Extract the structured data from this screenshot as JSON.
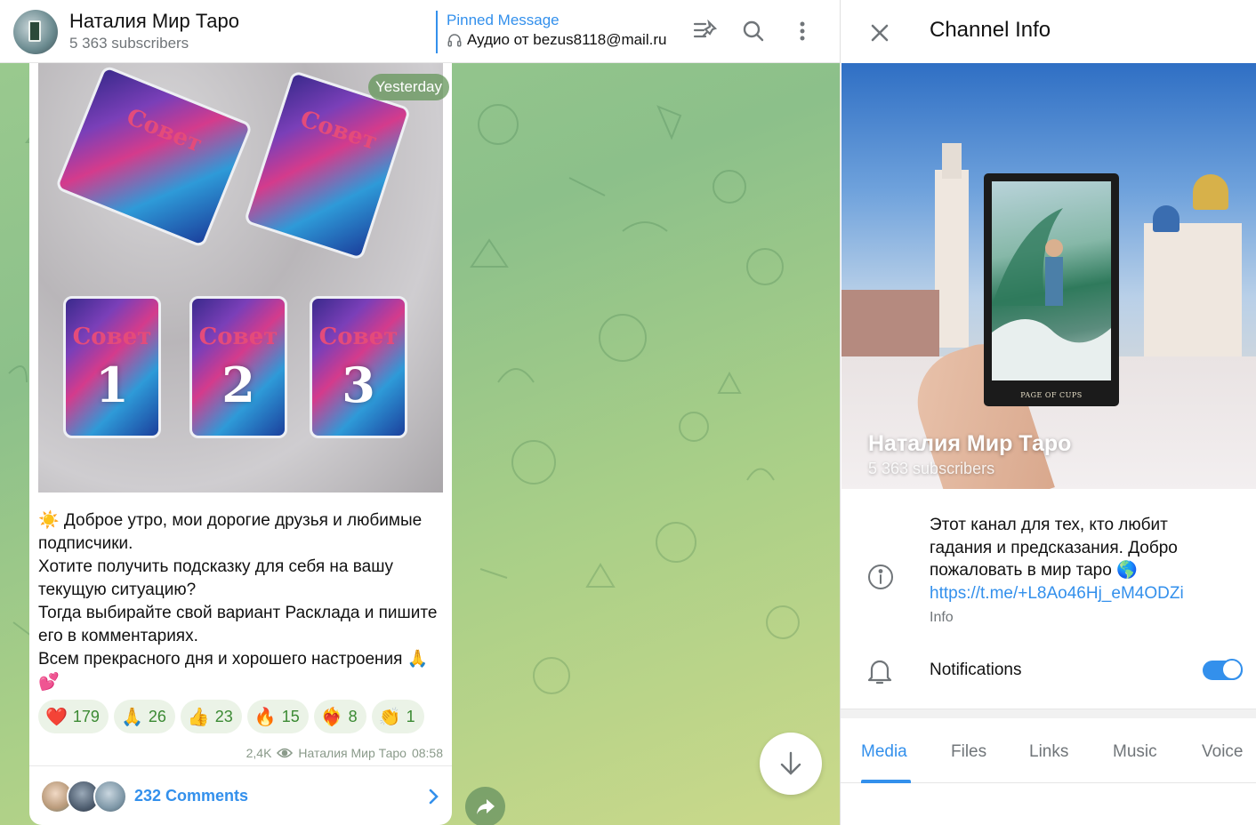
{
  "header": {
    "title": "Наталия Мир Таро",
    "subscribers": "5 363 subscribers",
    "pinned_label": "Pinned Message",
    "pinned_text": "Аудио от bezus8118@mail.ru"
  },
  "post": {
    "date_pill": "Yesterday",
    "image_cards": [
      "1",
      "2",
      "3"
    ],
    "image_card_face": "Совет",
    "text_lines": [
      "☀️ Доброе утро,  мои дорогие друзья и любимые подписчики.",
      "Хотите получить подсказку для себя на вашу текущую ситуацию?",
      "Тогда выбирайте свой вариант Расклада и пишите его в комментариях.",
      "Всем прекрасного дня и хорошего настроения 🙏💕"
    ],
    "reactions": [
      {
        "emoji": "❤️",
        "count": "179"
      },
      {
        "emoji": "🙏",
        "count": "26"
      },
      {
        "emoji": "👍",
        "count": "23"
      },
      {
        "emoji": "🔥",
        "count": "15"
      },
      {
        "emoji": "❤️‍🔥",
        "count": "8"
      },
      {
        "emoji": "👏",
        "count": "1"
      }
    ],
    "views": "2,4K",
    "author": "Наталия Мир Таро",
    "time": "08:58",
    "comments_label": "232 Comments"
  },
  "info": {
    "title": "Channel Info",
    "name": "Наталия Мир Таро",
    "subscribers": "5 363 subscribers",
    "card_caption": "PAGE OF CUPS",
    "description": "Этот канал для тех, кто любит гадания и предсказания. Добро пожаловать в мир таро 🌎",
    "link": "https://t.me/+L8Ao46Hj_eM4ODZi",
    "description_caption": "Info",
    "notifications_label": "Notifications",
    "notifications_on": true,
    "tabs": [
      "Media",
      "Files",
      "Links",
      "Music",
      "Voice"
    ],
    "active_tab": "Media"
  },
  "colors": {
    "accent": "#3390ec",
    "reaction_bg": "#ebf3e7",
    "reaction_text": "#3b8a33"
  },
  "icons": [
    "pinned-list-icon",
    "search-icon",
    "more-vertical-icon",
    "headphones-icon",
    "eye-icon",
    "chevron-right-icon",
    "share-icon",
    "arrow-down-icon",
    "close-icon",
    "info-icon",
    "bell-icon"
  ]
}
